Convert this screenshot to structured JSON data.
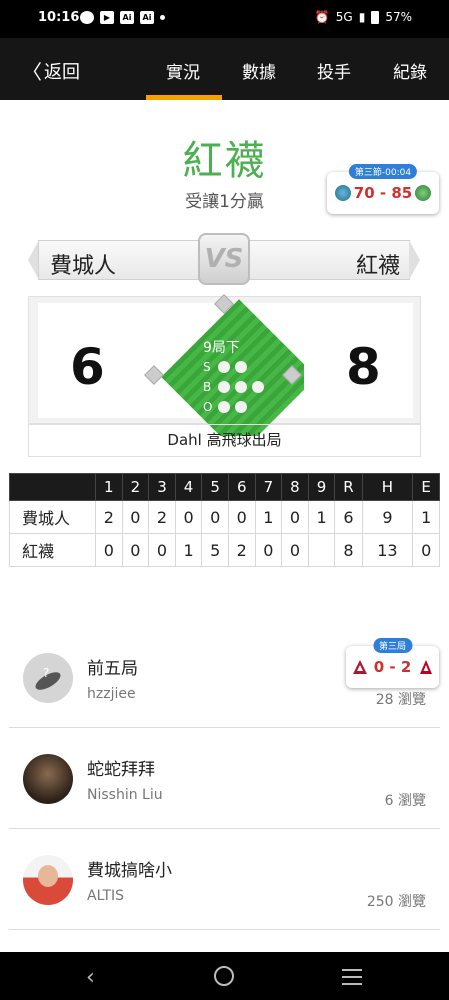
{
  "status_bar": {
    "time": "10:16",
    "network": "5G",
    "battery": "57%",
    "icons": [
      "message-icon",
      "youtube-icon",
      "ai-icon",
      "ai-icon",
      "dot-icon",
      "alarm-icon",
      "signal-icon",
      "battery-icon"
    ]
  },
  "nav": {
    "back_label": "返回",
    "tabs": [
      "實況",
      "數據",
      "投手",
      "紀錄"
    ],
    "active_tab": 0,
    "accent": "#f5a100"
  },
  "result": {
    "winner": "紅襪",
    "subtitle": "受讓1分贏"
  },
  "mini_game_top": {
    "badge": "第三節-00:04",
    "score": "70 - 85"
  },
  "matchup": {
    "away": "費城人",
    "home": "紅襪",
    "vs": "VS"
  },
  "scoreboard": {
    "away_score": "6",
    "home_score": "8",
    "inning": "9局下",
    "sbo": [
      "S",
      "B",
      "O"
    ],
    "play": "Dahl 高飛球出局"
  },
  "linescore": {
    "headers": [
      "1",
      "2",
      "3",
      "4",
      "5",
      "6",
      "7",
      "8",
      "9",
      "R",
      "H",
      "E"
    ],
    "rows": [
      {
        "team": "費城人",
        "cells": [
          "2",
          "0",
          "2",
          "0",
          "0",
          "0",
          "1",
          "0",
          "1",
          "6",
          "9",
          "1"
        ]
      },
      {
        "team": "紅襪",
        "cells": [
          "0",
          "0",
          "0",
          "1",
          "5",
          "2",
          "0",
          "0",
          "",
          "8",
          "13",
          "0"
        ]
      }
    ]
  },
  "mini_game_bottom": {
    "badge": "第三局",
    "score": "0 - 2"
  },
  "articles": [
    {
      "title": "前五局",
      "author": "hzzjiee",
      "views": "28 瀏覽"
    },
    {
      "title": "蛇蛇拜拜",
      "author": "Nisshin Liu",
      "views": "6 瀏覽"
    },
    {
      "title": "費城搞啥小",
      "author": "ALTIS",
      "views": "250 瀏覽"
    }
  ],
  "colors": {
    "winner": "#4caf50",
    "score_red": "#d32f2f",
    "badge_blue": "#2f7ed8",
    "field_green": "#3aa63a"
  }
}
